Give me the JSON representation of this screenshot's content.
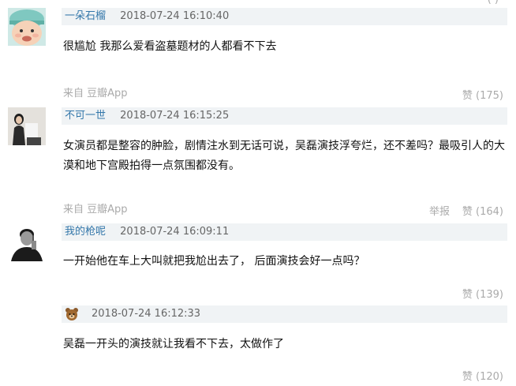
{
  "top_partial": "(   )",
  "comments": [
    {
      "user": "一朵石榴",
      "time": "2018-07-24 16:10:40",
      "text": "很尴尬 我那么爱看盗墓题材的人都看不下去",
      "source": "来自 豆瓣App",
      "vote": "赞 (175)"
    },
    {
      "user": "不可一世",
      "time": "2018-07-24 16:15:25",
      "text": "女演员都是整容的肿脸，剧情注水到无话可说，吴磊演技浮夸烂，还不差吗？最吸引人的大漠和地下宫殿拍得一点氛围都没有。",
      "source": "来自 豆瓣App",
      "report": "举报",
      "vote": "赞 (164)"
    },
    {
      "user": "我的枪呢",
      "time": "2018-07-24 16:09:11",
      "text": "一开始他在车上大叫就把我尬出去了， 后面演技会好一点吗？",
      "vote": "赞 (139)"
    },
    {
      "user": "",
      "time": "2018-07-24 16:12:33",
      "text": "吴磊一开头的演技就让我看不下去，太做作了",
      "vote": "赞 (120)"
    }
  ]
}
